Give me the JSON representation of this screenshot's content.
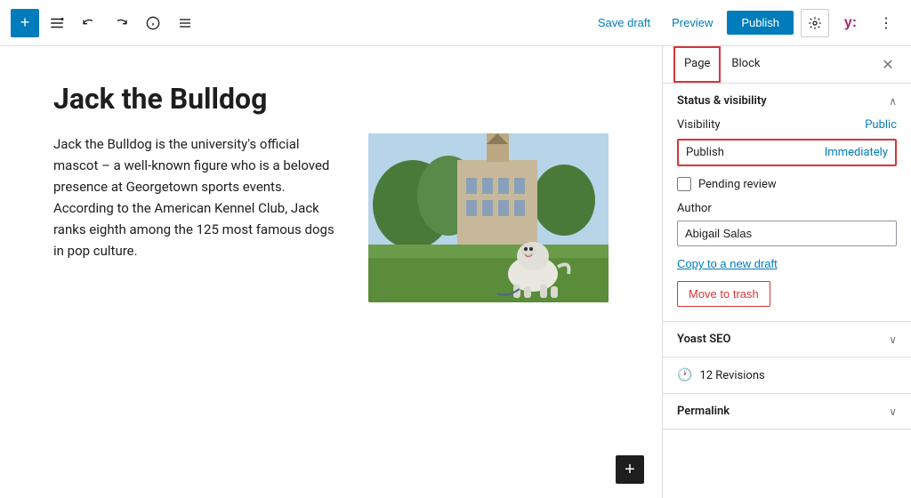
{
  "toolbar": {
    "add_label": "+",
    "save_draft_label": "Save draft",
    "preview_label": "Preview",
    "publish_label": "Publish",
    "more_icon": "⋮"
  },
  "editor": {
    "title": "Jack the Bulldog",
    "body_text": "Jack the Bulldog is the university's official mascot – a well-known figure who is a beloved presence at Georgetown sports events. According to the American Kennel Club, Jack ranks eighth among the 125 most famous dogs in pop culture."
  },
  "sidebar": {
    "tab_page_label": "Page",
    "tab_block_label": "Block",
    "close_icon": "✕",
    "status_visibility_title": "Status & visibility",
    "visibility_label": "Visibility",
    "visibility_value": "Public",
    "publish_label": "Publish",
    "publish_value": "Immediately",
    "pending_review_label": "Pending review",
    "author_label": "Author",
    "author_value": "Abigail Salas",
    "copy_draft_label": "Copy to a new draft",
    "move_trash_label": "Move to trash",
    "yoast_seo_title": "Yoast SEO",
    "revisions_icon": "🕐",
    "revisions_label": "12 Revisions",
    "permalink_title": "Permalink",
    "chevron_up": "∧",
    "chevron_down": "∨"
  }
}
